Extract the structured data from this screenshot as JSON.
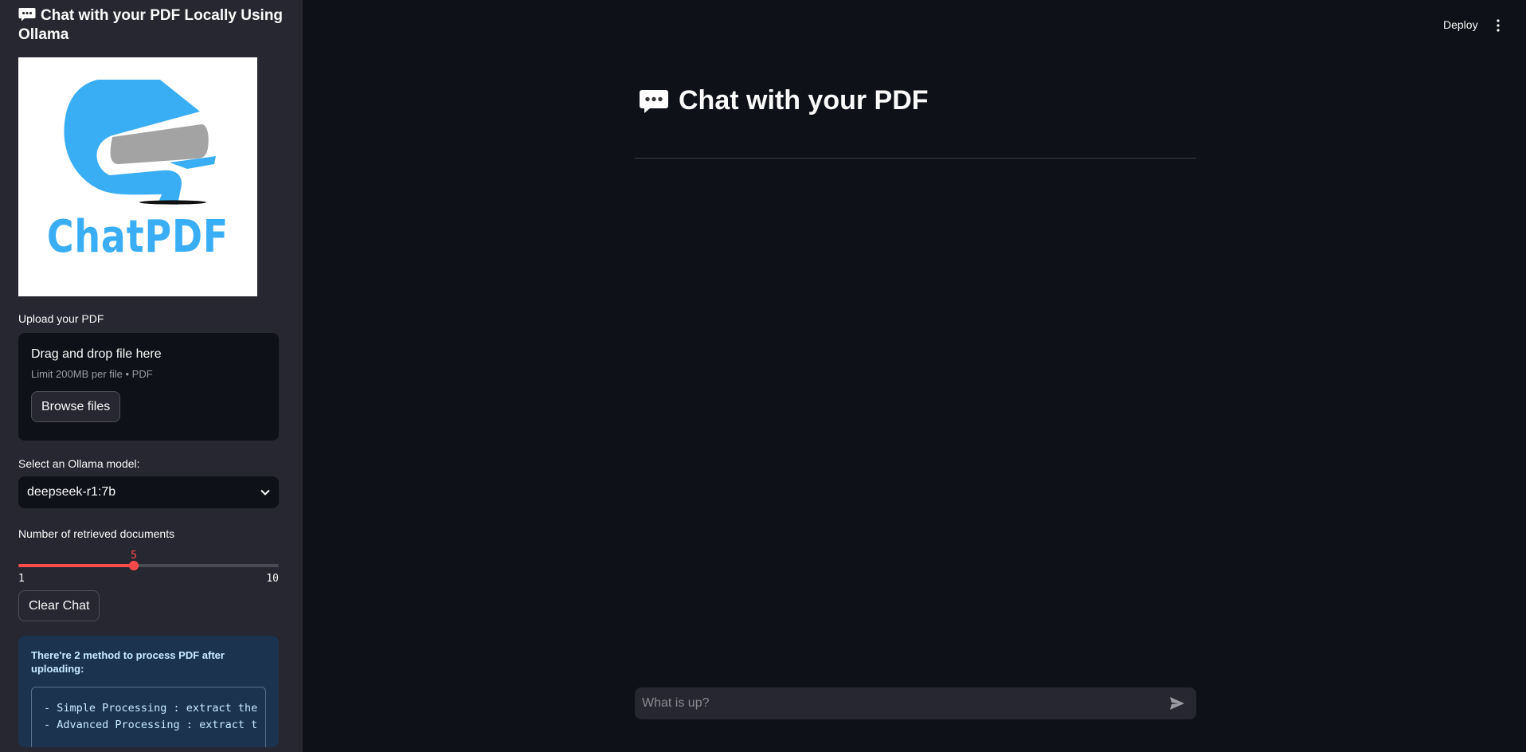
{
  "sidebar": {
    "title": "Chat with your PDF Locally Using Ollama",
    "logo_text": "ChatPDF",
    "upload": {
      "label": "Upload your PDF",
      "drop_text": "Drag and drop file here",
      "limit_text": "Limit 200MB per file • PDF",
      "browse_label": "Browse files"
    },
    "model": {
      "label": "Select an Ollama model:",
      "selected": "deepseek-r1:7b"
    },
    "slider": {
      "label": "Number of retrieved documents",
      "value": "5",
      "min": "1",
      "max": "10"
    },
    "clear_label": "Clear Chat",
    "info": {
      "text": "There're 2 method to process PDF after uploading:",
      "code_lines": "- Simple Processing : extract the\n- Advanced Processing : extract t"
    }
  },
  "header": {
    "deploy_label": "Deploy",
    "menu_icon": "vertical-dots-icon"
  },
  "main": {
    "title": "Chat with your PDF",
    "chat_placeholder": "What is up?",
    "send_icon": "send-icon"
  },
  "colors": {
    "background": "#0e1117",
    "sidebar": "#262730",
    "accent": "#ff4b4b",
    "logo_blue": "#3aaef5",
    "info_bg": "#1c3350"
  }
}
